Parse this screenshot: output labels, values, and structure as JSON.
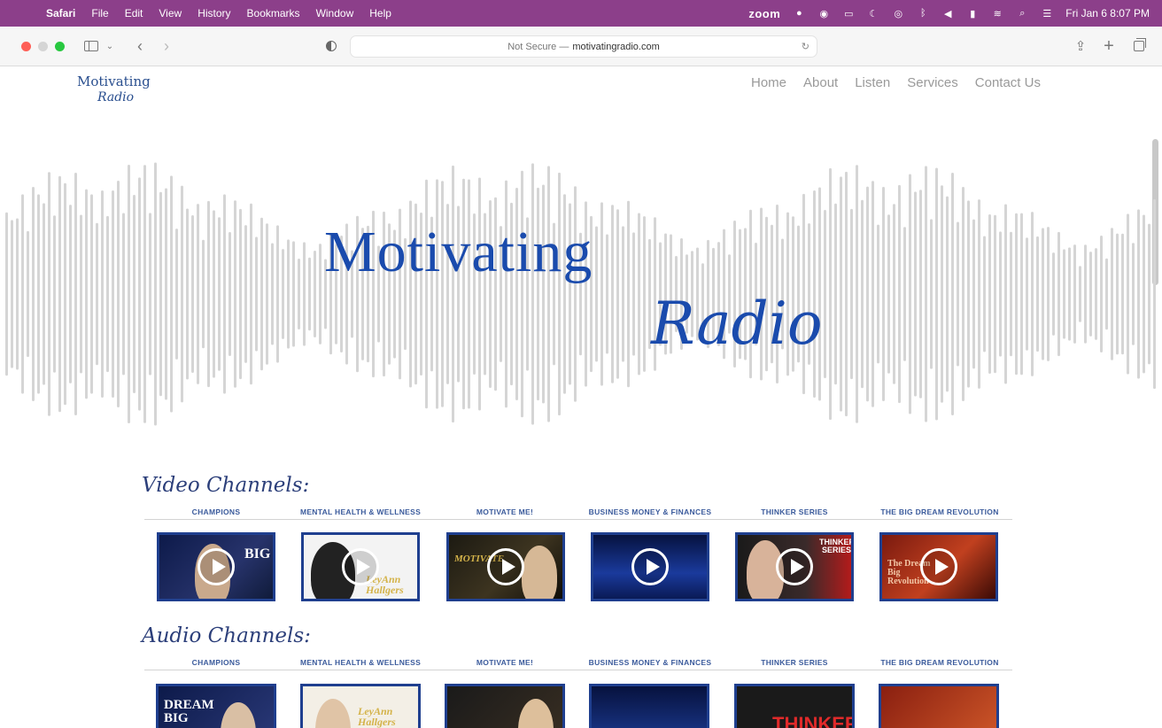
{
  "menubar": {
    "app": "Safari",
    "items": [
      "File",
      "Edit",
      "View",
      "History",
      "Bookmarks",
      "Window",
      "Help"
    ],
    "zoom": "zoom",
    "clock": "Fri Jan 6  8:07 PM",
    "status_icons": [
      "record-icon",
      "play-circle-icon",
      "screen-mirror-icon",
      "moon-icon",
      "airdrop-icon",
      "bluetooth-icon",
      "volume-icon",
      "battery-icon",
      "wifi-icon",
      "search-icon",
      "control-center-icon"
    ]
  },
  "toolbar": {
    "url_prefix": "Not Secure —",
    "url_domain": "motivatingradio.com"
  },
  "site": {
    "logo_line1": "Motivating",
    "logo_line2": "Radio",
    "nav": [
      "Home",
      "About",
      "Listen",
      "Services",
      "Contact Us"
    ],
    "hero_title": "Motivating",
    "hero_subtitle": "Radio"
  },
  "video_section": {
    "title": "Video Channels:",
    "categories": [
      "CHAMPIONS",
      "MENTAL HEALTH & WELLNESS",
      "MOTIVATE ME!",
      "BUSINESS MONEY & FINANCES",
      "THINKER SERIES",
      "THE BIG DREAM REVOLUTION"
    ],
    "thumb_texts": [
      "BIG",
      "LeyAnn Hallgers",
      "MOTIVATE",
      "",
      "THINKER SERIES",
      "The Dream Big Revolution"
    ]
  },
  "audio_section": {
    "title": "Audio Channels:",
    "categories": [
      "CHAMPIONS",
      "MENTAL HEALTH & WELLNESS",
      "MOTIVATE ME!",
      "BUSINESS MONEY & FINANCES",
      "THINKER SERIES",
      "THE BIG DREAM REVOLUTION"
    ],
    "thumb_texts": [
      "DREAM BIG",
      "LeyAnn Hallgers",
      "",
      "",
      "THINKER",
      ""
    ]
  },
  "colors": {
    "menubar": "#8c3f8a",
    "brand_blue": "#1a4bad",
    "nav_gray": "#9a9a9a",
    "waveform": "#d5d5d5"
  }
}
